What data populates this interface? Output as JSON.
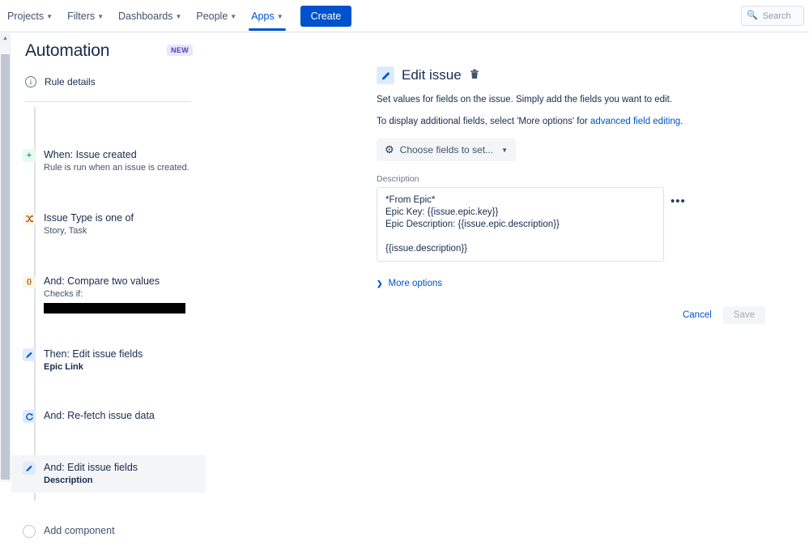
{
  "topnav": {
    "items": [
      {
        "label": "Projects",
        "has_chevron": true,
        "active": false
      },
      {
        "label": "Filters",
        "has_chevron": true,
        "active": false
      },
      {
        "label": "Dashboards",
        "has_chevron": true,
        "active": false
      },
      {
        "label": "People",
        "has_chevron": true,
        "active": false
      },
      {
        "label": "Apps",
        "has_chevron": true,
        "active": true
      }
    ],
    "create_label": "Create",
    "search_placeholder": "Search",
    "search_value": "",
    "search_icon": "search-icon",
    "accent_color": "#0052cc"
  },
  "sidebar": {
    "title": "Automation",
    "badge": "NEW",
    "badge_bg": "#eae6ff",
    "badge_color": "#5243aa",
    "rule_details": {
      "label": "Rule details",
      "icon": "info-icon"
    },
    "add_component": {
      "label": "Add component",
      "icon": "plus-circle-icon"
    },
    "components": [
      {
        "title": "When: Issue created",
        "subtitle": "Rule is run when an issue is created.",
        "icon": "plus-icon",
        "icon_style": "green",
        "icon_glyph": "+",
        "selected": false,
        "redacted": false
      },
      {
        "title": "Issue Type is one of",
        "subtitle": "Story, Task",
        "icon": "branch-icon",
        "icon_style": "yellow",
        "icon_glyph": "⚯",
        "selected": false,
        "redacted": false
      },
      {
        "title": "And: Compare two values",
        "subtitle": "Checks if:",
        "icon": "braces-icon",
        "icon_style": "yellow",
        "icon_glyph": "{}",
        "selected": false,
        "redacted": true
      },
      {
        "title": "Then: Edit issue fields",
        "subtitle": "Epic Link",
        "subtitle_bold": true,
        "icon": "pencil-icon",
        "icon_style": "blue",
        "icon_glyph": "✏",
        "selected": false,
        "redacted": false
      },
      {
        "title": "And: Re-fetch issue data",
        "subtitle": "",
        "icon": "refresh-icon",
        "icon_style": "blue",
        "icon_glyph": "↻",
        "selected": false,
        "redacted": false
      },
      {
        "title": "And: Edit issue fields",
        "subtitle": "Description",
        "subtitle_bold": true,
        "icon": "pencil-icon",
        "icon_style": "blue",
        "icon_glyph": "✏",
        "selected": true,
        "redacted": false
      }
    ]
  },
  "main": {
    "icon": "pencil-icon",
    "icon_glyph": "✏",
    "title": "Edit issue",
    "delete_icon": "trash-icon",
    "description_line1": "Set values for fields on the issue. Simply add the fields you want to edit.",
    "description_line2_prefix": "To display additional fields, select 'More options' for ",
    "description_link": "advanced field editing",
    "description_line2_suffix": ".",
    "choose_fields": {
      "label": "Choose fields to set...",
      "gear_icon": "gear-icon",
      "chevron_icon": "chevron-down-icon"
    },
    "field": {
      "label": "Description",
      "value": "*From Epic*\nEpic Key: {{issue.epic.key}}\nEpic Description: {{issue.epic.description}}\n\n{{issue.description}}",
      "more_icon": "ellipsis-icon",
      "more_glyph": "•••"
    },
    "more_options": {
      "label": "More options",
      "chevron_icon": "chevron-right-icon",
      "chevron_glyph": "❯"
    },
    "cancel_label": "Cancel",
    "save_label": "Save",
    "save_disabled": true
  }
}
